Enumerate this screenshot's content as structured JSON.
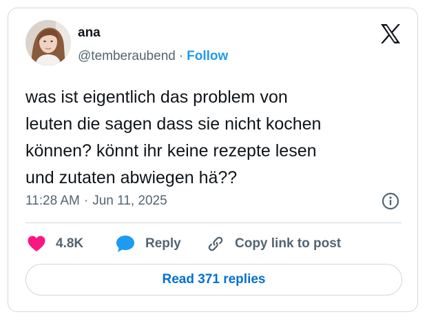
{
  "author": {
    "display_name": "ana",
    "handle": "@temberaubend",
    "separator": "·",
    "follow_label": "Follow"
  },
  "tweet": {
    "text": "was ist eigentlich das problem von\nleuten die sagen dass sie nicht kochen\nkönnen? könnt ihr keine rezepte lesen\nund zutaten abwiegen hä??",
    "time": "11:28 AM",
    "separator": "·",
    "date": "Jun 11, 2025"
  },
  "actions": {
    "likes_count": "4.8K",
    "reply_label": "Reply",
    "copy_link_label": "Copy link to post"
  },
  "read_replies_label": "Read 371 replies",
  "icons": {
    "brand": "x-logo-icon",
    "info": "info-icon",
    "like": "heart-icon",
    "reply": "speech-bubble-icon",
    "copy": "link-icon"
  },
  "colors": {
    "text": "#0f1419",
    "muted": "#536471",
    "accent": "#1d9bf0",
    "like": "#f91880",
    "reply": "#1d9bf0",
    "border": "#cfd9de",
    "read_replies": "#006fd6"
  }
}
